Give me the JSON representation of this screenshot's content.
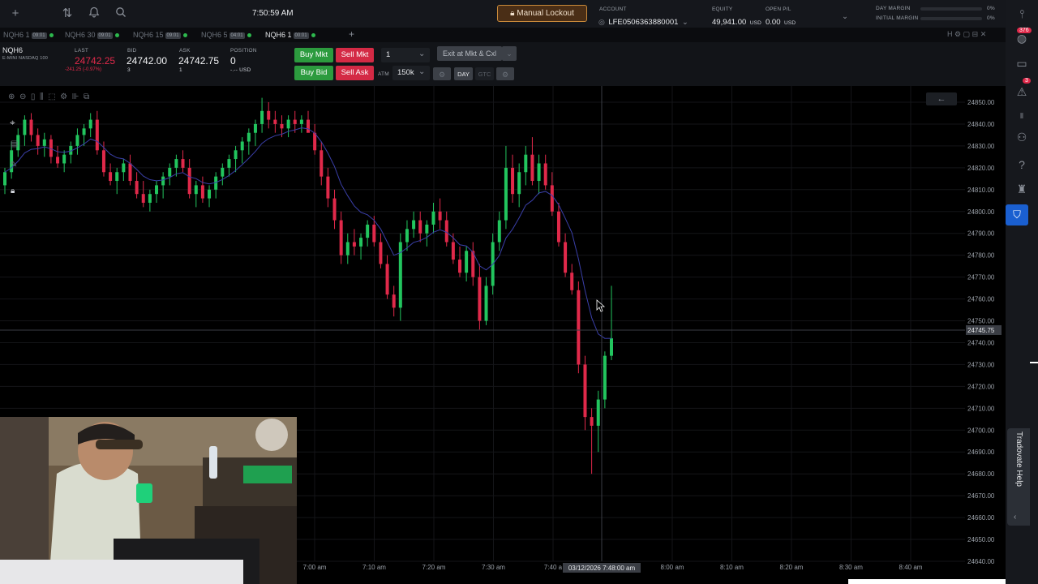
{
  "topbar": {
    "clock": "7:50:59 AM",
    "manual_lockout": "Manual Lockout",
    "account_label": "ACCOUNT",
    "account_value": "LFE0506363880001",
    "equity_label": "EQUITY",
    "equity_value": "49,941.00",
    "equity_unit": "USD",
    "openpl_label": "OPEN P/L",
    "openpl_value": "0.00",
    "openpl_unit": "USD",
    "day_margin_label": "DAY MARGIN",
    "day_margin_value": "0%",
    "initial_margin_label": "INITIAL MARGIN",
    "initial_margin_value": "0%"
  },
  "tabs": [
    {
      "label": "NQH6 1",
      "chip": "09:01"
    },
    {
      "label": "NQH6 30",
      "chip": "09:01"
    },
    {
      "label": "NQH6 15",
      "chip": "09:01"
    },
    {
      "label": "NQH6 5",
      "chip": "04:01"
    },
    {
      "label": "NQH6 1",
      "chip": "00:01"
    }
  ],
  "quote": {
    "symbol": "NQH6",
    "symbol_desc": "E-MINI NASDAQ 100",
    "last_label": "LAST",
    "last_value": "24742.25",
    "last_change": "-241.25 (-0.97%)",
    "bid_label": "BID",
    "bid_value": "24742.00",
    "bid_size": "3",
    "ask_label": "ASK",
    "ask_value": "24742.75",
    "ask_size": "1",
    "pos_label": "POSITION",
    "pos_value": "0",
    "pos_unit": "-.-- USD",
    "buy_mkt": "Buy Mkt",
    "sell_mkt": "Sell Mkt",
    "buy_bid": "Buy Bid",
    "sell_ask": "Sell Ask",
    "qty": "1",
    "exit_label": "Exit at Mkt & Cxl",
    "atm_label": "ATM",
    "atm_value": "150k",
    "day": "DAY",
    "gtc": "GTC"
  },
  "rail": {
    "badge_top": "376",
    "badge_alert": "3"
  },
  "help": "Tradovate Help",
  "chart_data": {
    "type": "candlestick",
    "price_labels": [
      "24850.00",
      "24840.00",
      "24830.00",
      "24820.00",
      "24810.00",
      "24800.00",
      "24790.00",
      "24780.00",
      "24770.00",
      "24760.00",
      "24750.00",
      "24740.00",
      "24730.00",
      "24720.00",
      "24710.00",
      "24700.00",
      "24690.00",
      "24680.00",
      "24670.00",
      "24660.00",
      "24650.00",
      "24640.00"
    ],
    "current_price": "24745.75",
    "time_labels": [
      "7:00 am",
      "7:10 am",
      "7:20 am",
      "7:30 am",
      "7:40 a",
      "8:00 am",
      "8:10 am",
      "8:20 am",
      "8:30 am",
      "8:40 am"
    ],
    "crosshair_time": "03/12/2026 7:48:00 am",
    "ylim": [
      24640,
      24850
    ],
    "up_color": "#22c55e",
    "down_color": "#e0294a",
    "candles": [
      [
        24812,
        24820,
        24808,
        24818
      ],
      [
        24818,
        24832,
        24815,
        24828
      ],
      [
        24828,
        24838,
        24825,
        24835
      ],
      [
        24835,
        24844,
        24830,
        24842
      ],
      [
        24842,
        24845,
        24832,
        24835
      ],
      [
        24835,
        24838,
        24826,
        24830
      ],
      [
        24830,
        24836,
        24825,
        24833
      ],
      [
        24833,
        24835,
        24822,
        24825
      ],
      [
        24825,
        24830,
        24820,
        24822
      ],
      [
        24822,
        24828,
        24818,
        24826
      ],
      [
        24826,
        24832,
        24822,
        24830
      ],
      [
        24830,
        24838,
        24826,
        24835
      ],
      [
        24835,
        24840,
        24830,
        24838
      ],
      [
        24838,
        24845,
        24834,
        24842
      ],
      [
        24842,
        24846,
        24826,
        24828
      ],
      [
        24828,
        24832,
        24816,
        24818
      ],
      [
        24818,
        24822,
        24812,
        24814
      ],
      [
        24814,
        24820,
        24808,
        24818
      ],
      [
        24818,
        24824,
        24814,
        24822
      ],
      [
        24822,
        24826,
        24812,
        24814
      ],
      [
        24814,
        24818,
        24806,
        24808
      ],
      [
        24808,
        24814,
        24802,
        24804
      ],
      [
        24804,
        24810,
        24800,
        24808
      ],
      [
        24808,
        24814,
        24804,
        24812
      ],
      [
        24812,
        24818,
        24806,
        24816
      ],
      [
        24816,
        24822,
        24812,
        24820
      ],
      [
        24820,
        24826,
        24816,
        24824
      ],
      [
        24824,
        24828,
        24818,
        24820
      ],
      [
        24820,
        24824,
        24806,
        24808
      ],
      [
        24808,
        24814,
        24802,
        24812
      ],
      [
        24812,
        24816,
        24804,
        24806
      ],
      [
        24806,
        24812,
        24802,
        24810
      ],
      [
        24810,
        24818,
        24806,
        24816
      ],
      [
        24816,
        24822,
        24812,
        24820
      ],
      [
        24820,
        24826,
        24816,
        24824
      ],
      [
        24824,
        24830,
        24818,
        24828
      ],
      [
        24828,
        24834,
        24822,
        24832
      ],
      [
        24832,
        24838,
        24826,
        24836
      ],
      [
        24836,
        24842,
        24830,
        24840
      ],
      [
        24840,
        24852,
        24836,
        24846
      ],
      [
        24846,
        24850,
        24838,
        24842
      ],
      [
        24842,
        24846,
        24836,
        24840
      ],
      [
        24840,
        24844,
        24834,
        24838
      ],
      [
        24838,
        24844,
        24834,
        24842
      ],
      [
        24842,
        24846,
        24836,
        24840
      ],
      [
        24840,
        24844,
        24836,
        24842
      ],
      [
        24842,
        24846,
        24838,
        24836
      ],
      [
        24836,
        24840,
        24826,
        24828
      ],
      [
        24828,
        24832,
        24812,
        24816
      ],
      [
        24816,
        24820,
        24802,
        24806
      ],
      [
        24806,
        24810,
        24792,
        24796
      ],
      [
        24796,
        24800,
        24776,
        24780
      ],
      [
        24780,
        24790,
        24776,
        24786
      ],
      [
        24786,
        24792,
        24780,
        24784
      ],
      [
        24784,
        24790,
        24778,
        24788
      ],
      [
        24788,
        24796,
        24784,
        24794
      ],
      [
        24794,
        24798,
        24784,
        24786
      ],
      [
        24786,
        24790,
        24774,
        24776
      ],
      [
        24776,
        24780,
        24760,
        24762
      ],
      [
        24762,
        24766,
        24752,
        24756
      ],
      [
        24756,
        24790,
        24750,
        24786
      ],
      [
        24786,
        24796,
        24782,
        24792
      ],
      [
        24792,
        24800,
        24788,
        24796
      ],
      [
        24796,
        24800,
        24786,
        24790
      ],
      [
        24790,
        24796,
        24784,
        24794
      ],
      [
        24794,
        24804,
        24790,
        24800
      ],
      [
        24800,
        24806,
        24792,
        24796
      ],
      [
        24796,
        24800,
        24784,
        24786
      ],
      [
        24786,
        24790,
        24776,
        24778
      ],
      [
        24778,
        24784,
        24770,
        24772
      ],
      [
        24772,
        24784,
        24768,
        24782
      ],
      [
        24782,
        24786,
        24766,
        24770
      ],
      [
        24770,
        24776,
        24746,
        24750
      ],
      [
        24750,
        24770,
        24748,
        24766
      ],
      [
        24766,
        24790,
        24762,
        24786
      ],
      [
        24786,
        24800,
        24782,
        24796
      ],
      [
        24796,
        24830,
        24792,
        24820
      ],
      [
        24820,
        24826,
        24804,
        24808
      ],
      [
        24808,
        24822,
        24802,
        24818
      ],
      [
        24818,
        24830,
        24812,
        24826
      ],
      [
        24826,
        24834,
        24812,
        24814
      ],
      [
        24814,
        24826,
        24808,
        24822
      ],
      [
        24822,
        24826,
        24810,
        24812
      ],
      [
        24812,
        24818,
        24798,
        24800
      ],
      [
        24800,
        24804,
        24784,
        24786
      ],
      [
        24786,
        24790,
        24770,
        24772
      ],
      [
        24772,
        24776,
        24762,
        24764
      ],
      [
        24764,
        24768,
        24726,
        24730
      ],
      [
        24730,
        24734,
        24700,
        24706
      ],
      [
        24706,
        24710,
        24680,
        24702
      ],
      [
        24702,
        24718,
        24690,
        24714
      ],
      [
        24714,
        24736,
        24710,
        24734
      ],
      [
        24734,
        24766,
        24732,
        24742
      ]
    ]
  }
}
